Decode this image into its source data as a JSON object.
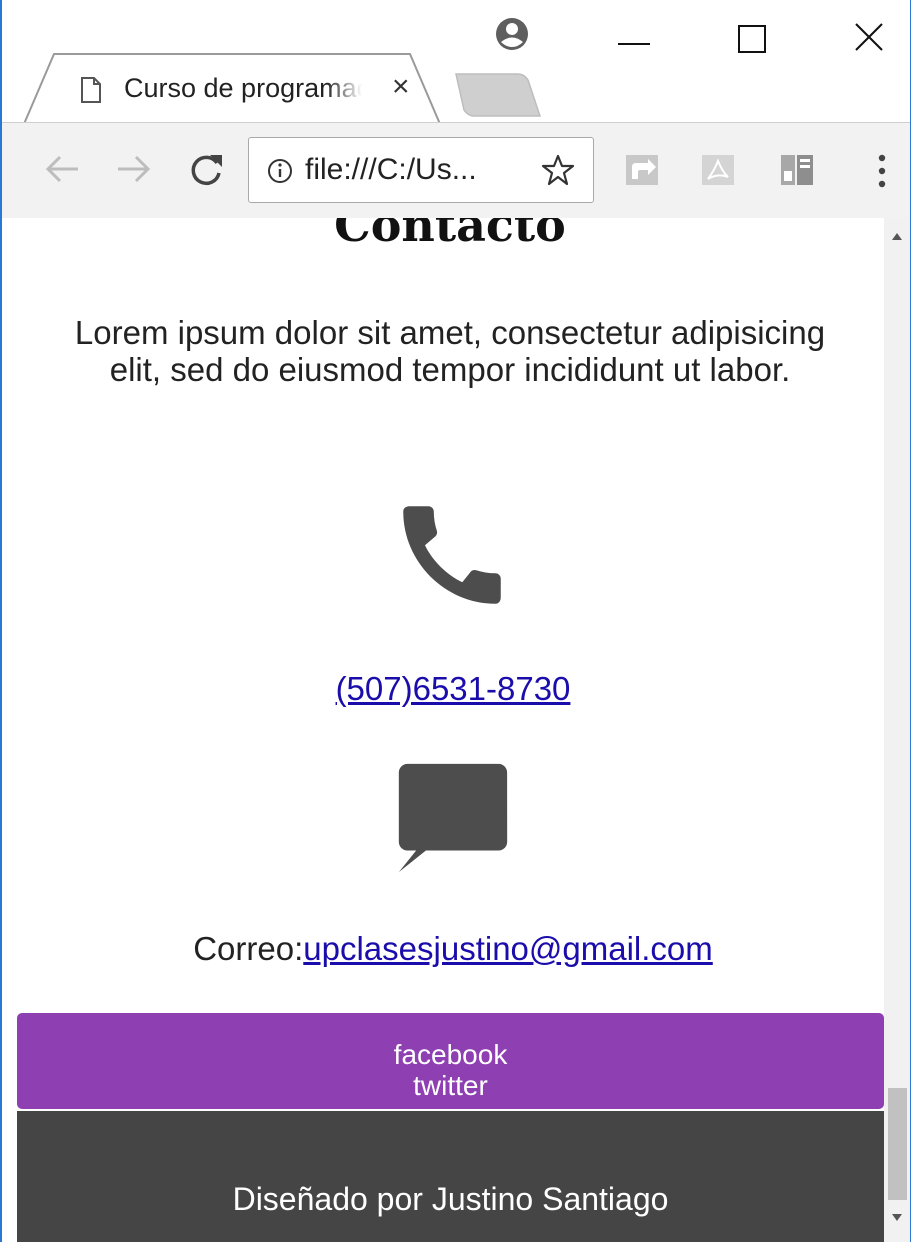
{
  "browser": {
    "tab_title": "Curso de programación",
    "tab_close": "×",
    "url": "file:///C:/Us...",
    "icons": {
      "page": "document-icon",
      "profile": "profile-icon",
      "back": "back-arrow-icon",
      "forward": "forward-arrow-icon",
      "reload": "reload-icon",
      "info": "info-icon",
      "bookmark": "star-icon",
      "extensions": [
        "share-extension-icon",
        "pdf-extension-icon",
        "reader-extension-icon"
      ],
      "menu": "more-vert-icon"
    }
  },
  "page": {
    "heading": "Contacto",
    "intro": "Lorem ipsum dolor sit amet, consectetur adipisicing elit, sed do eiusmod tempor incididunt ut labor.",
    "phone": "(507)6531-8730",
    "email_label": "Correo:",
    "email": "upclasesjustino@gmail.com",
    "social": [
      "facebook",
      "twitter"
    ],
    "footer": "Diseñado por Justino Santiago"
  },
  "colors": {
    "social_bg": "#8e3fb2",
    "footer_bg": "#454545",
    "link": "#1a0dab",
    "icon": "#4d4d4d",
    "window_border": "#2b78d4"
  }
}
